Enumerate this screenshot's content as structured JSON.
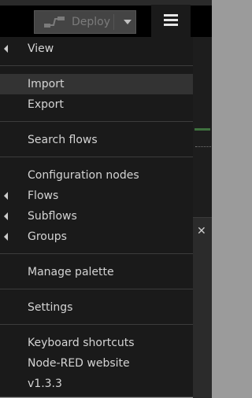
{
  "header": {
    "deploy_label": "Deploy",
    "deploy_icon": "deploy-flow-icon",
    "menu_icon": "hamburger-menu-icon"
  },
  "menu": {
    "items": [
      {
        "label": "View",
        "submenu": true
      },
      {
        "label": "Import",
        "submenu": false,
        "active": true
      },
      {
        "label": "Export",
        "submenu": false
      },
      {
        "label": "Search flows",
        "submenu": false
      },
      {
        "label": "Configuration nodes",
        "submenu": false
      },
      {
        "label": "Flows",
        "submenu": true
      },
      {
        "label": "Subflows",
        "submenu": true
      },
      {
        "label": "Groups",
        "submenu": true
      },
      {
        "label": "Manage palette",
        "submenu": false
      },
      {
        "label": "Settings",
        "submenu": false
      },
      {
        "label": "Keyboard shortcuts",
        "submenu": false
      },
      {
        "label": "Node-RED website",
        "submenu": false
      },
      {
        "label": "v1.3.3",
        "submenu": false
      }
    ]
  },
  "sidebar": {
    "close_icon": "close-icon"
  },
  "colors": {
    "menu_bg": "#1a1a1a",
    "menu_text": "#d4d4d4",
    "active_bg": "#333333",
    "header_bg": "#000000"
  }
}
